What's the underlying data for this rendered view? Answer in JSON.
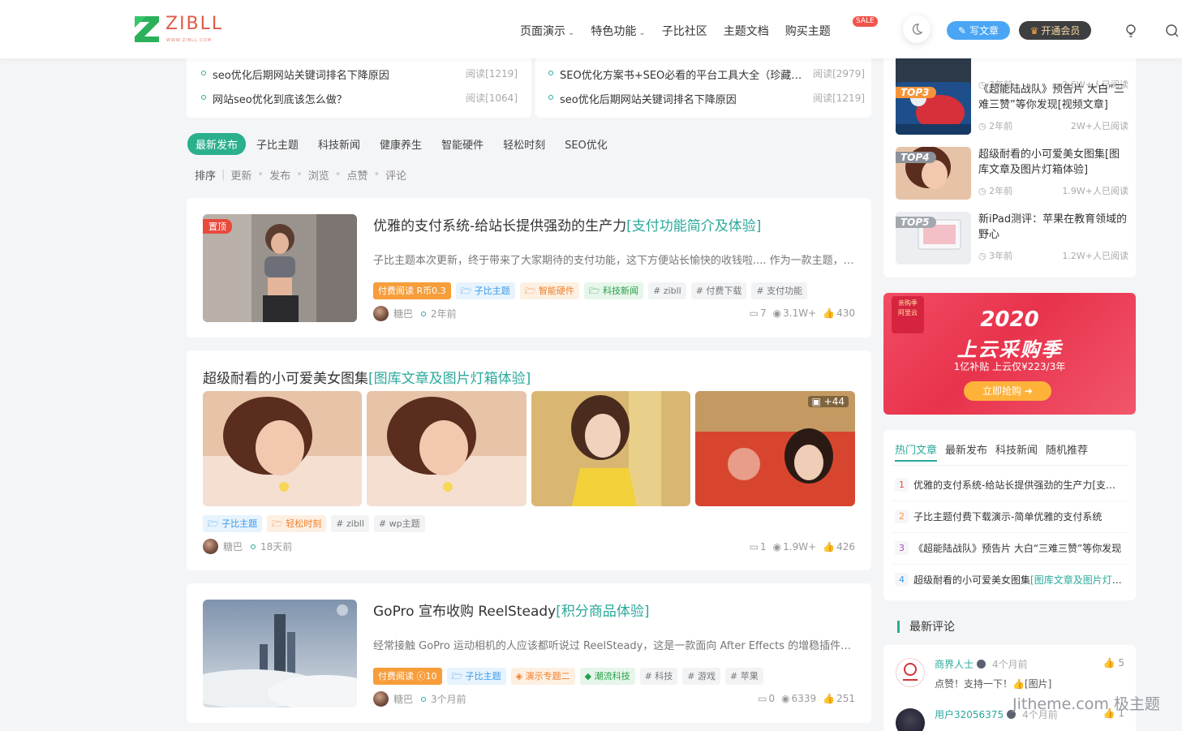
{
  "header": {
    "logo_text": "ZIBLL",
    "logo_sub": "WWW.ZIBLL.COM",
    "nav": [
      {
        "label": "页面演示",
        "dropdown": true
      },
      {
        "label": "特色功能",
        "dropdown": true
      },
      {
        "label": "子比社区",
        "dropdown": false
      },
      {
        "label": "主题文档",
        "dropdown": false
      },
      {
        "label": "购买主题",
        "dropdown": false
      }
    ],
    "sale_badge": "SALE",
    "write_button": "写文章",
    "vip_button": "开通会员"
  },
  "top_lists": [
    [
      {
        "title": "seo优化后期网站关键词排名下降原因",
        "reads": "阅读[1219]"
      },
      {
        "title": "网站seo优化到底该怎么做？",
        "reads": "阅读[1064]"
      }
    ],
    [
      {
        "title": "SEO优化方案书+SEO必看的平台工具大全（珍藏版）",
        "reads": "阅读[2979]"
      },
      {
        "title": "seo优化后期网站关键词排名下降原因",
        "reads": "阅读[1219]"
      }
    ]
  ],
  "tabs": [
    "最新发布",
    "子比主题",
    "科技新闻",
    "健康养生",
    "智能硬件",
    "轻松时刻",
    "SEO优化"
  ],
  "sort": [
    "排序",
    "更新",
    "发布",
    "浏览",
    "点赞",
    "评论"
  ],
  "posts": [
    {
      "badge": "置顶",
      "title": "优雅的支付系统-给站长提供强劲的生产力",
      "title_hl": "[支付功能简介及体验]",
      "excerpt": "子比主题本次更新，终于带来了大家期待的支付功能，这下方便站长愉快的收钱啦.... 作为一款主题，支付功能的加入，让站长更加方便地进行内容变现",
      "tags": [
        {
          "label": "付费阅读 R币0.3",
          "style": "pay"
        },
        {
          "label": "子比主题",
          "style": "blue",
          "icon": "folder-icon"
        },
        {
          "label": "智能硬件",
          "style": "orange",
          "icon": "folder-icon"
        },
        {
          "label": "科技新闻",
          "style": "green",
          "icon": "folder-icon"
        },
        {
          "label": "# zibll",
          "style": "gray"
        },
        {
          "label": "# 付费下载",
          "style": "gray"
        },
        {
          "label": "# 支付功能",
          "style": "gray"
        }
      ],
      "author": "糖巴",
      "time": "2年前",
      "comments": "7",
      "views": "3.1W+",
      "likes": "430"
    },
    {
      "title": "超级耐看的小可爱美女图集",
      "title_hl": "[图库文章及图片灯箱体验]",
      "more_images": "+44",
      "tags": [
        {
          "label": "子比主题",
          "style": "blue",
          "icon": "folder-icon"
        },
        {
          "label": "轻松时刻",
          "style": "orange",
          "icon": "folder-icon"
        },
        {
          "label": "# zibll",
          "style": "gray"
        },
        {
          "label": "# wp主题",
          "style": "gray"
        }
      ],
      "author": "糖巴",
      "time": "18天前",
      "comments": "1",
      "views": "1.9W+",
      "likes": "426"
    },
    {
      "title": "GoPro 宣布收购 ReelSteady",
      "title_hl": "[积分商品体验]",
      "excerpt": "经常接触 GoPro 运动相机的人应该都听说过 ReelSteady，这是一款面向 After Effects 的增稳插件，可以让运动画面变得平稳",
      "tags": [
        {
          "label": "付费阅读 ⓒ10",
          "style": "pay"
        },
        {
          "label": "子比主题",
          "style": "blue",
          "icon": "folder-icon"
        },
        {
          "label": "演示专题二",
          "style": "orange",
          "icon": "tag-icon"
        },
        {
          "label": "潮流科技",
          "style": "green",
          "icon": "cube-icon"
        },
        {
          "label": "# 科技",
          "style": "gray"
        },
        {
          "label": "# 游戏",
          "style": "gray"
        },
        {
          "label": "# 苹果",
          "style": "gray"
        }
      ],
      "author": "糖巴",
      "time": "3个月前",
      "comments": "0",
      "views": "6339",
      "likes": "251"
    }
  ],
  "ranking": [
    {
      "badge": "",
      "title": "",
      "time": "3年前",
      "views": "2.6W+人已阅读"
    },
    {
      "badge": "TOP3",
      "title": "《超能陆战队》预告片 大白“三难三赞”等你发现[视频文章]",
      "time": "2年前",
      "views": "2W+人已阅读"
    },
    {
      "badge": "TOP4",
      "title": "超级耐看的小可爱美女图集[图库文章及图片灯箱体验]",
      "time": "2年前",
      "views": "1.9W+人已阅读"
    },
    {
      "badge": "TOP5",
      "title": "新iPad测评：苹果在教育领域的野心",
      "time": "3年前",
      "views": "1.2W+人已阅读"
    }
  ],
  "ad": {
    "badge": "亲购季",
    "brand": "阿里云",
    "year": "2020",
    "slogan": "上云采购季",
    "sub": "1亿补贴 上云仅¥223/3年",
    "cta": "立即抢购"
  },
  "hot": {
    "tabs": [
      "热门文章",
      "最新发布",
      "科技新闻",
      "随机推荐"
    ],
    "items": [
      {
        "n": "1",
        "title": "优雅的支付系统-给站长提供强劲的生产力[支付功能简介及体验]",
        "hl": ""
      },
      {
        "n": "2",
        "title": "子比主题付费下载演示-简单优雅的支付系统",
        "hl": ""
      },
      {
        "n": "3",
        "title": "《超能陆战队》预告片 大白“三难三赞”等你发现",
        "hl": ""
      },
      {
        "n": "4",
        "title": "超级耐看的小可爱美女图集",
        "hl": "[图库文章及图片灯箱体验]"
      }
    ]
  },
  "comments": {
    "heading": "最新评论",
    "items": [
      {
        "name": "商界人士",
        "time": "4个月前",
        "likes": "5",
        "text": "点赞！支持一下！👍[图片]"
      },
      {
        "name": "用户32056375",
        "time": "4个月前",
        "likes": "1",
        "text": ""
      }
    ]
  },
  "watermark": "Jitheme.com 极主题",
  "colors": {
    "accent": "#2aa99b",
    "brand_green": "#2bb08e",
    "logo_red": "#e05a47"
  }
}
